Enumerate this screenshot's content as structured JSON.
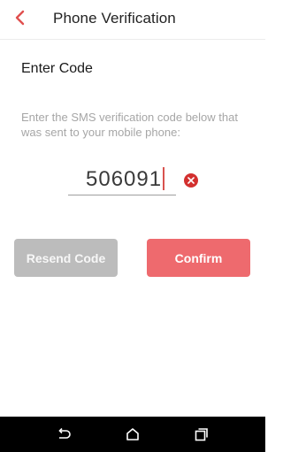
{
  "header": {
    "title": "Phone Verification",
    "back_icon": "chevron-left-icon",
    "accent_color": "#e0504f"
  },
  "content": {
    "section_title": "Enter Code",
    "instructions": "Enter the SMS verification code below that was sent to your mobile phone:"
  },
  "code_input": {
    "value": "506091",
    "clear_icon": "clear-circle-x-icon"
  },
  "buttons": {
    "resend_label": "Resend Code",
    "confirm_label": "Confirm"
  },
  "colors": {
    "resend_bg": "#bcbcbc",
    "confirm_bg": "#ee6a6e",
    "clear_icon": "#d3302f"
  },
  "nav_bar": {
    "back_icon": "nav-back-icon",
    "home_icon": "nav-home-icon",
    "recents_icon": "nav-recents-icon"
  }
}
